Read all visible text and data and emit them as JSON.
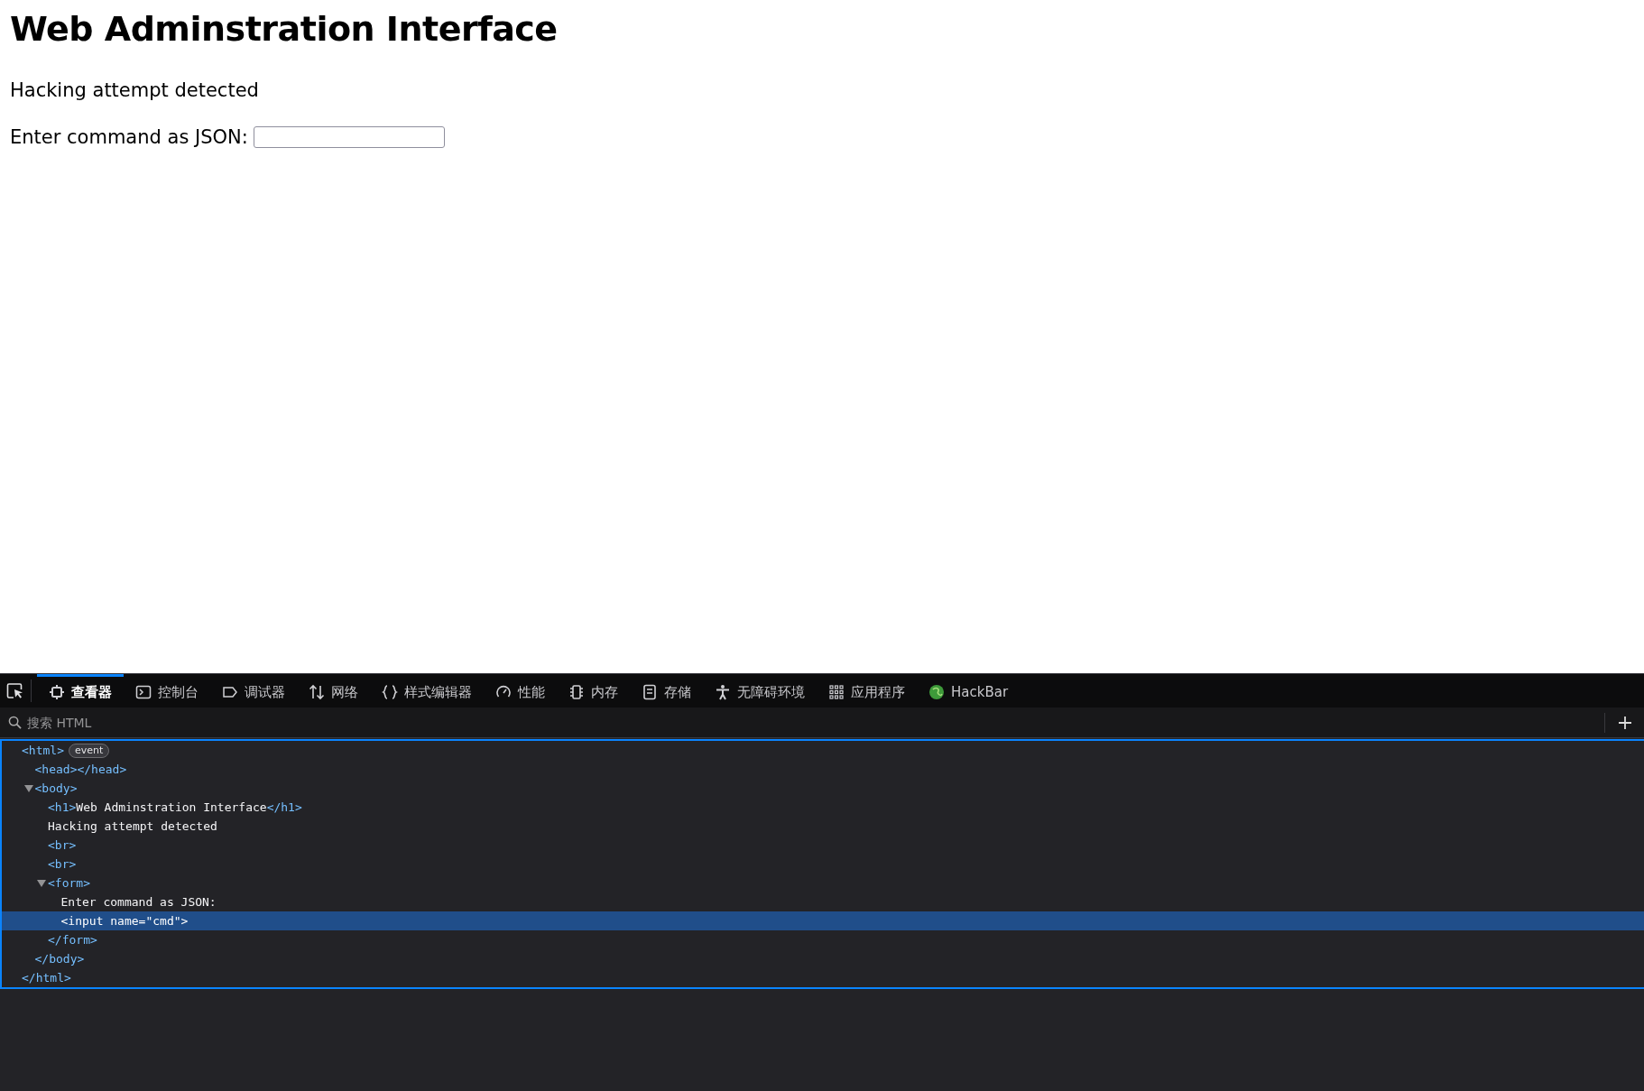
{
  "page": {
    "heading": "Web Adminstration Interface",
    "message": "Hacking attempt detected",
    "form": {
      "label": "Enter command as JSON:"
    }
  },
  "devtools": {
    "tabs": [
      {
        "label": "查看器",
        "selected": true
      },
      {
        "label": "控制台",
        "selected": false
      },
      {
        "label": "调试器",
        "selected": false
      },
      {
        "label": "网络",
        "selected": false
      },
      {
        "label": "样式编辑器",
        "selected": false
      },
      {
        "label": "性能",
        "selected": false
      },
      {
        "label": "内存",
        "selected": false
      },
      {
        "label": "存储",
        "selected": false
      },
      {
        "label": "无障碍环境",
        "selected": false
      },
      {
        "label": "应用程序",
        "selected": false
      },
      {
        "label": "HackBar",
        "selected": false
      }
    ],
    "search": {
      "placeholder": "搜索 HTML"
    },
    "tree": [
      {
        "kind": "element",
        "open": "<html>",
        "badge": "event",
        "selected": false,
        "close": "</html>",
        "children": [
          {
            "kind": "element",
            "open": "<head>",
            "close": "</head>",
            "selected": false
          },
          {
            "kind": "element",
            "open": "<body>",
            "expanded": true,
            "selected": false,
            "close": "</body>",
            "children": [
              {
                "kind": "element",
                "open": "<h1>",
                "content": "Web Adminstration Interface",
                "close": "</h1>",
                "selected": false
              },
              {
                "kind": "text",
                "content": "Hacking attempt detected",
                "selected": false
              },
              {
                "kind": "element",
                "open": "<br>",
                "selected": false
              },
              {
                "kind": "element",
                "open": "<br>",
                "selected": false
              },
              {
                "kind": "element",
                "open": "<form>",
                "expanded": true,
                "selected": false,
                "close": "</form>",
                "children": [
                  {
                    "kind": "text",
                    "content": "Enter command as JSON:",
                    "selected": false
                  },
                  {
                    "kind": "element",
                    "open": "<input name=\"cmd\">",
                    "selected": true
                  }
                ]
              }
            ]
          }
        ]
      }
    ]
  }
}
